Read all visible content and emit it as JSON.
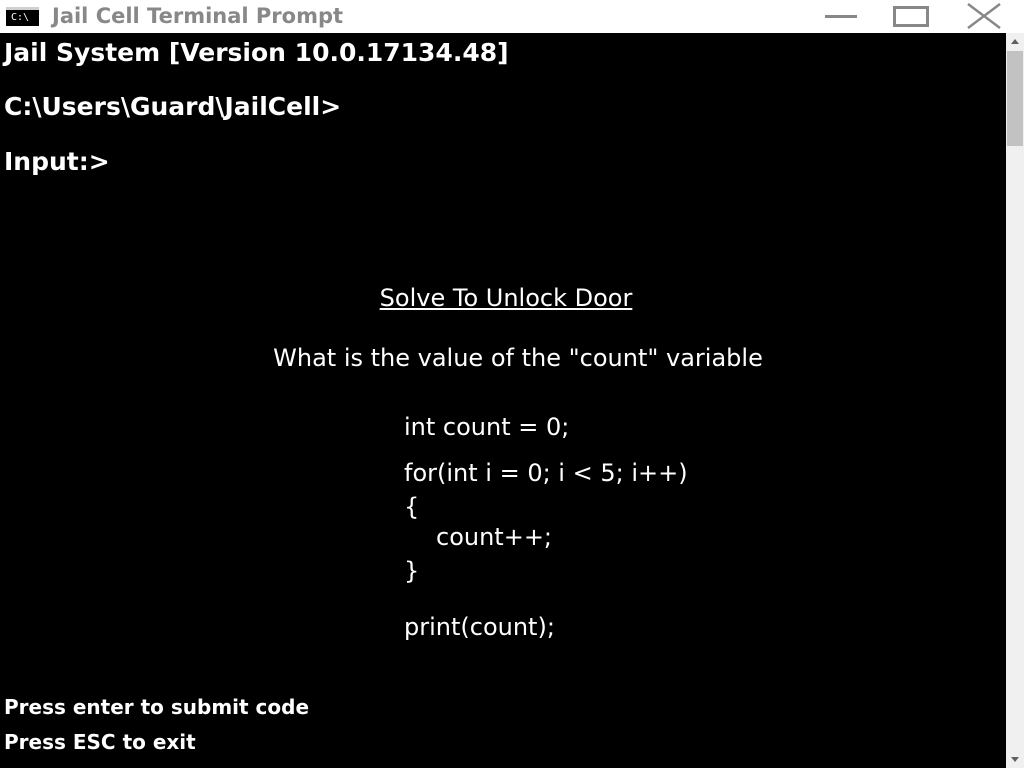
{
  "window": {
    "title": "Jail Cell Terminal Prompt",
    "icon_label": "C:\\",
    "icon": "console-icon",
    "controls": {
      "minimize": "minimize-icon",
      "maximize": "maximize-icon",
      "close": "close-icon"
    }
  },
  "console": {
    "system_version": "Jail System [Version 10.0.17134.48]",
    "current_path": "C:\\Users\\Guard\\JailCell>",
    "input_prompt": "Input:>",
    "input_value": ""
  },
  "puzzle": {
    "title": "Solve To Unlock Door",
    "question": "What is the value of the \"count\" variable",
    "code_lines": [
      "int count = 0;",
      "for(int i = 0; i < 5; i++)",
      "{",
      "count++;",
      "}",
      "print(count);"
    ]
  },
  "hints": {
    "submit": "Press enter to submit code",
    "exit": "Press ESC to exit"
  },
  "colors": {
    "background": "#000000",
    "text": "#ffffff",
    "titlebar": "#ffffff",
    "titlebar_text": "#888888",
    "scrollbar_track": "#f0f0f0",
    "scrollbar_thumb": "#c2c2c2"
  }
}
